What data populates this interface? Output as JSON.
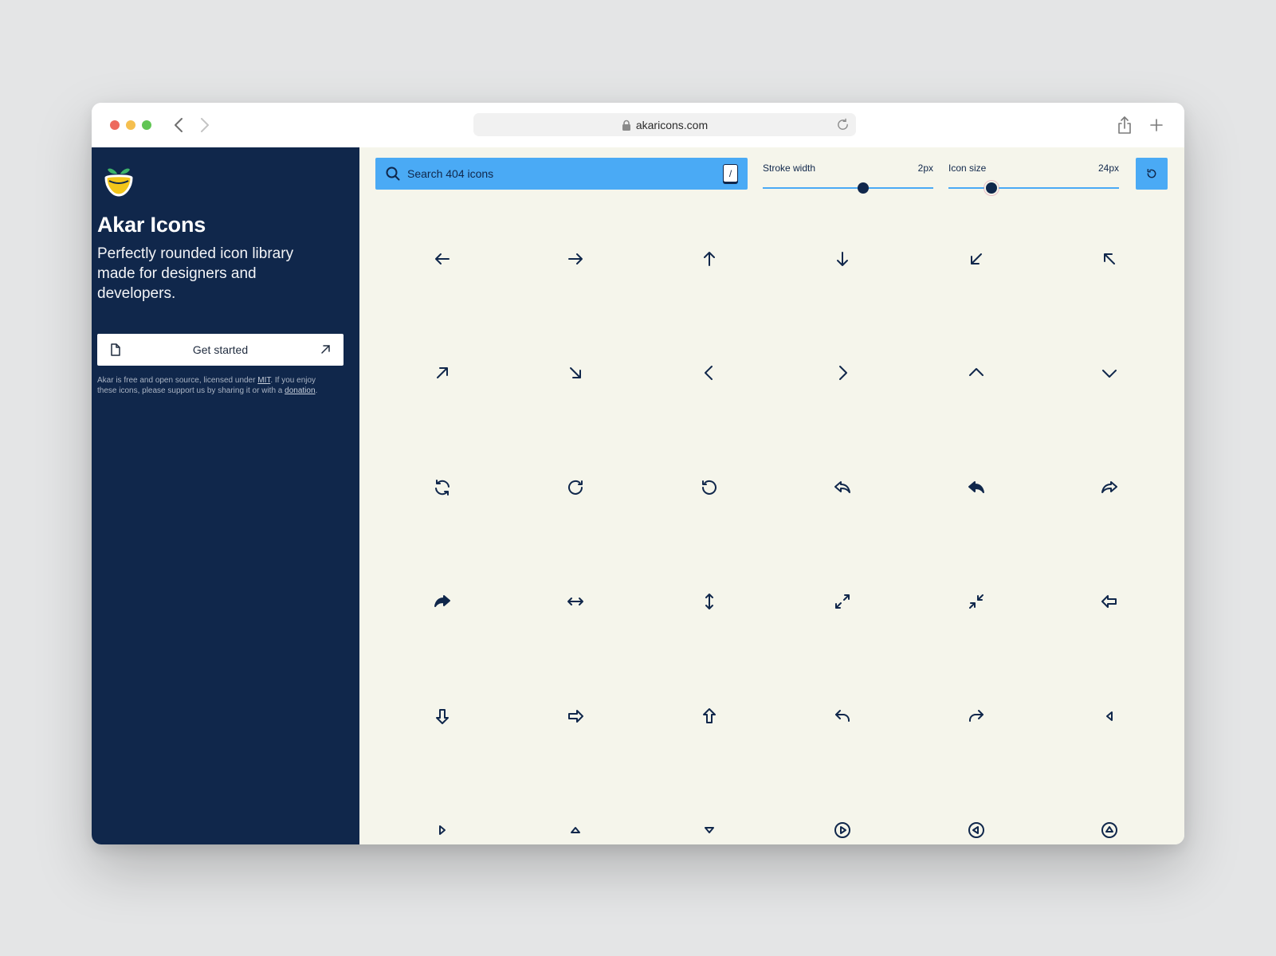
{
  "browser": {
    "url": "akaricons.com"
  },
  "sidebar": {
    "title": "Akar Icons",
    "tagline": "Perfectly rounded icon library made for designers and developers.",
    "cta_label": "Get started",
    "license_prefix": "Akar is free and open source, licensed under ",
    "license_link": "MIT",
    "license_middle": ". If you enjoy these icons, please support us by sharing it or with a ",
    "donation_link": "donation",
    "license_suffix": "."
  },
  "toolbar": {
    "search_placeholder": "Search 404 icons",
    "search_shortcut": "/",
    "stroke_label": "Stroke width",
    "stroke_value": "2px",
    "stroke_fraction": 0.59,
    "size_label": "Icon size",
    "size_value": "24px",
    "size_fraction": 0.25
  },
  "colors": {
    "sidebar_bg": "#10274b",
    "main_bg": "#f5f5eb",
    "accent": "#4aaaf5",
    "icon": "#10274b"
  },
  "icons": [
    "arrow-left-icon",
    "arrow-right-icon",
    "arrow-up-icon",
    "arrow-down-icon",
    "arrow-down-left-icon",
    "arrow-up-left-icon",
    "arrow-up-right-icon",
    "arrow-down-right-icon",
    "chevron-left-icon",
    "chevron-right-icon",
    "chevron-up-icon",
    "chevron-down-icon",
    "arrow-cycle-icon",
    "arrow-clockwise-icon",
    "arrow-counter-clockwise-icon",
    "arrow-back-thick-icon",
    "arrow-back-thick-fill-icon",
    "arrow-forward-thick-icon",
    "arrow-forward-thick-fill-icon",
    "arrow-left-right-icon",
    "arrow-up-down-icon",
    "enlarge-icon",
    "reduce-icon",
    "arrow-left-thick-icon",
    "arrow-down-thick-icon",
    "arrow-right-thick-icon",
    "arrow-up-thick-icon",
    "arrow-back-icon",
    "arrow-forward-icon",
    "triangle-left-icon",
    "triangle-right-icon",
    "triangle-up-icon",
    "triangle-down-icon",
    "circle-triangle-right-icon",
    "circle-triangle-left-icon",
    "circle-triangle-up-icon"
  ]
}
